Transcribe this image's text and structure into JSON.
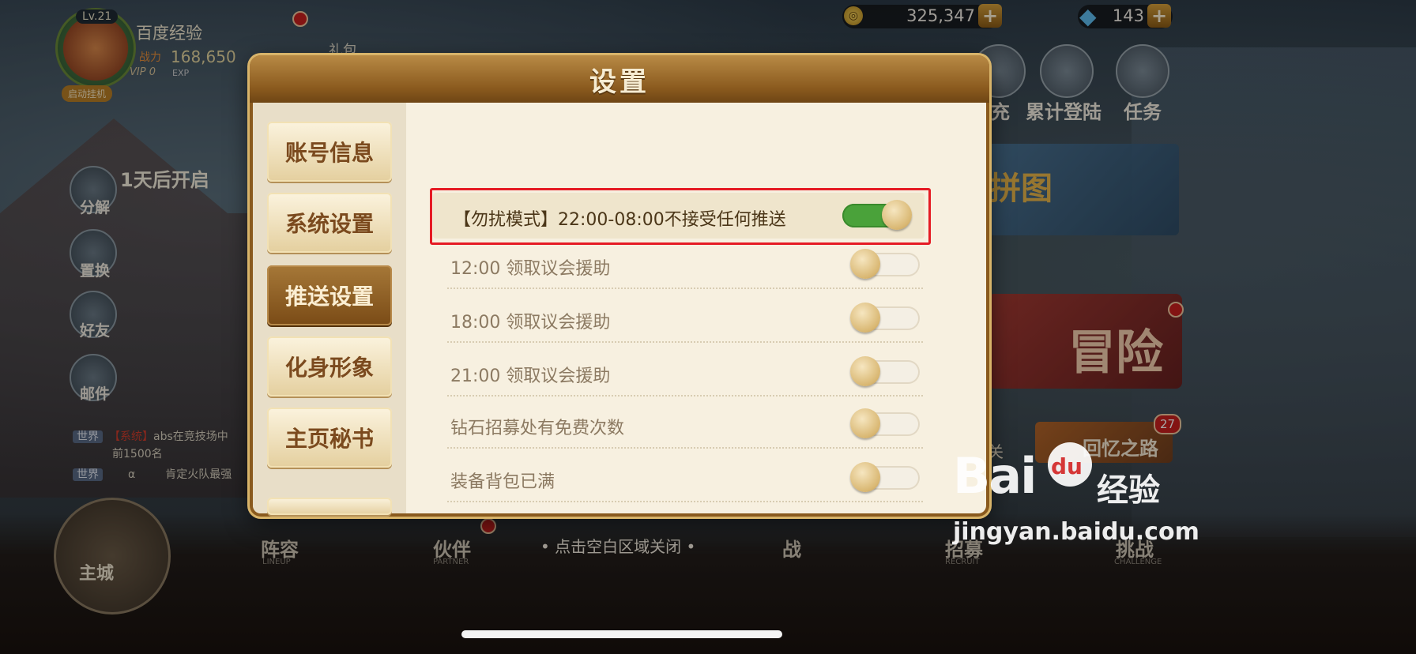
{
  "player": {
    "level": "Lv.21",
    "name": "百度经验",
    "power_label": "战力",
    "power": "168,650",
    "vip": "VIP 0",
    "exp_label": "EXP",
    "auto_fight": "启动挂机"
  },
  "top_left": {
    "gift_label": "礼包",
    "open_hint": "1天后开启"
  },
  "side_menu": [
    "分解",
    "置换",
    "好友",
    "邮件"
  ],
  "chat": {
    "line1_tag": "世界",
    "line1_sys": "【系统】",
    "line1_text": "abs在竞技场中",
    "line2_text": "前1500名",
    "line3_tag": "世界",
    "line3_name": "α",
    "line3_text": "肯定火队最强"
  },
  "currency": {
    "coin_icon": "gold-coin-icon",
    "coins": "325,347",
    "gem_icon": "diamond-icon",
    "gems": "143"
  },
  "right_menu": {
    "recharge": "充",
    "login": "累计登陆",
    "task": "任务",
    "puzzle": "拼图",
    "adventure": "冒险",
    "memory": "回忆之路",
    "memory_badge": "27",
    "level_label": "关"
  },
  "bottom_nav": {
    "main_city": "主城",
    "lineup": "阵容",
    "lineup_sub": "LINEUP",
    "partner": "伙伴",
    "partner_sub": "PARTNER",
    "close_hint": "• 点击空白区域关闭 •",
    "recruit": "招募",
    "recruit_sub": "RECRUIT",
    "challenge": "挑战",
    "challenge_sub": "CHALLENGE",
    "lock_label": "战"
  },
  "dialog": {
    "title": "设置",
    "tabs": [
      {
        "label": "账号信息",
        "active": false
      },
      {
        "label": "系统设置",
        "active": false
      },
      {
        "label": "推送设置",
        "active": true
      },
      {
        "label": "化身形象",
        "active": false
      },
      {
        "label": "主页秘书",
        "active": false
      }
    ],
    "settings": [
      {
        "label": "【勿扰模式】22:00-08:00不接受任何推送",
        "on": true
      },
      {
        "label": "12:00 领取议会援助",
        "on": false
      },
      {
        "label": "18:00 领取议会援助",
        "on": false
      },
      {
        "label": "21:00 领取议会援助",
        "on": false
      },
      {
        "label": "钻石招募处有免费次数",
        "on": false
      },
      {
        "label": "装备背包已满",
        "on": false
      }
    ]
  },
  "watermark": {
    "brand_left": "Bai",
    "brand_paw": "du",
    "brand_right": "经验",
    "url": "jingyan.baidu.com"
  }
}
